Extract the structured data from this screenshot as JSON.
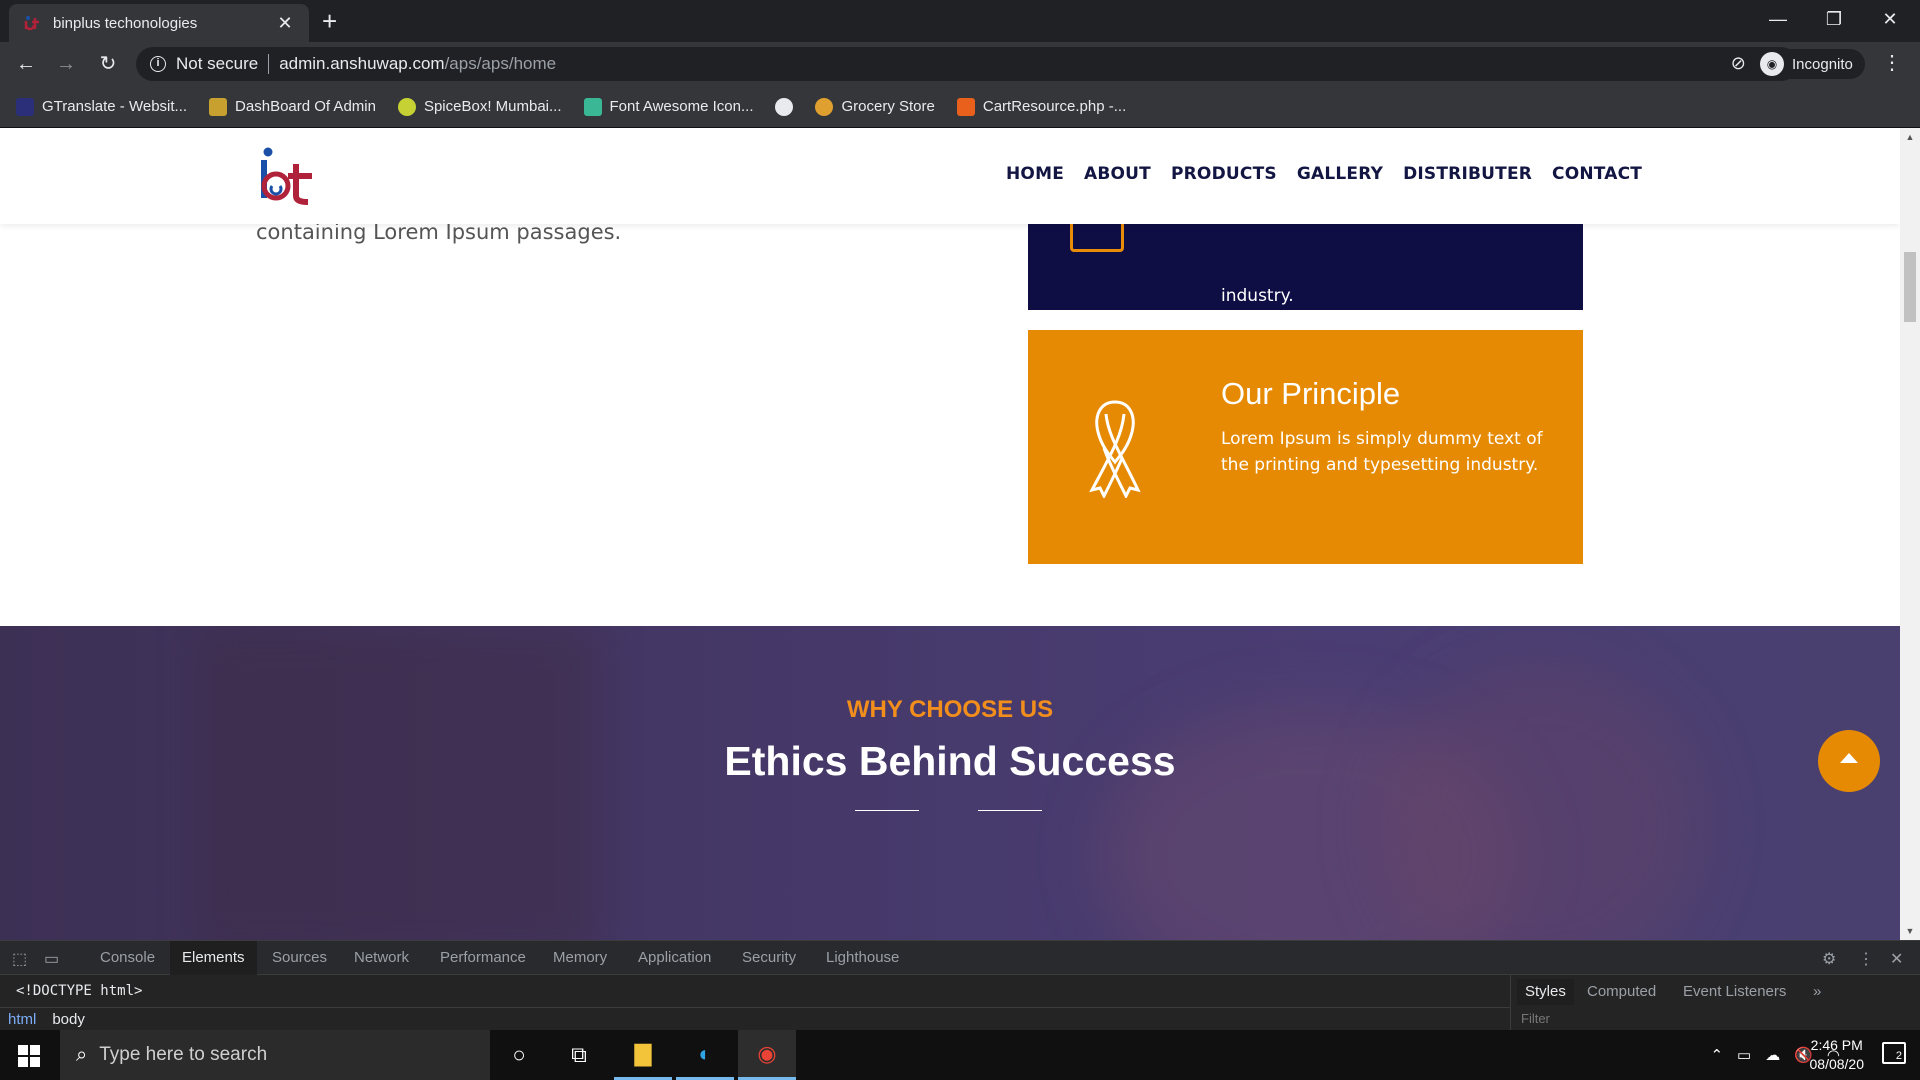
{
  "browser": {
    "tab_title": "binplus techonologies",
    "new_tab_symbol": "+",
    "close_symbol": "✕",
    "security_label": "Not secure",
    "url_host": "admin.anshuwap.com",
    "url_path": "/aps/aps/home",
    "incognito_label": "Incognito",
    "bookmarks": [
      {
        "label": "GTranslate - Websit...",
        "icon_color": "#2b2f7a"
      },
      {
        "label": "DashBoard Of Admin",
        "icon_color": "#c8a030"
      },
      {
        "label": "SpiceBox! Mumbai...",
        "icon_color": "#c6d233"
      },
      {
        "label": "Font Awesome Icon...",
        "icon_color": "#3ab795"
      },
      {
        "label": "",
        "icon_color": "#e8eaed"
      },
      {
        "label": "Grocery Store",
        "icon_color": "#e0a030"
      },
      {
        "label": "CartResource.php -...",
        "icon_color": "#e8601c"
      }
    ]
  },
  "site": {
    "nav": [
      "HOME",
      "ABOUT",
      "PRODUCTS",
      "GALLERY",
      "DISTRIBUTER",
      "CONTACT"
    ],
    "left_text": "containing Lorem Ipsum passages.",
    "navy_card_text": "industry.",
    "principle_title": "Our Principle",
    "principle_text": "Lorem Ipsum is simply dummy text of the printing and typesetting industry.",
    "why_kicker": "WHY CHOOSE US",
    "why_title": "Ethics Behind Success",
    "colors": {
      "navy": "#0e0e45",
      "orange": "#e58a02",
      "nav_text": "#131542"
    }
  },
  "devtools": {
    "tabs": [
      "Console",
      "Elements",
      "Sources",
      "Network",
      "Performance",
      "Memory",
      "Application",
      "Security",
      "Lighthouse"
    ],
    "active_tab": "Elements",
    "doctype": "<!DOCTYPE html>",
    "crumbs": [
      "html",
      "body"
    ],
    "side_tabs": [
      "Styles",
      "Computed",
      "Event Listeners"
    ],
    "filter_placeholder": "Filter",
    "more_symbol": "»"
  },
  "taskbar": {
    "search_placeholder": "Type here to search",
    "time": "2:46 PM",
    "date": "08/08/20",
    "notification_count": "2"
  }
}
